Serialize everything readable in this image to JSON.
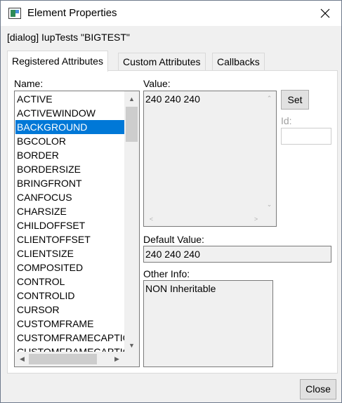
{
  "window": {
    "title": "Element Properties",
    "app_icon": "dialog-app-icon",
    "close_icon": "close-icon"
  },
  "element_label": "[dialog] IupTests \"BIGTEST\"",
  "tabs": [
    {
      "label": "Registered Attributes",
      "active": true
    },
    {
      "label": "Custom Attributes",
      "active": false
    },
    {
      "label": "Callbacks",
      "active": false
    }
  ],
  "name_label": "Name:",
  "attributes": [
    "ACTIVE",
    "ACTIVEWINDOW",
    "BACKGROUND",
    "BGCOLOR",
    "BORDER",
    "BORDERSIZE",
    "BRINGFRONT",
    "CANFOCUS",
    "CHARSIZE",
    "CHILDOFFSET",
    "CLIENTOFFSET",
    "CLIENTSIZE",
    "COMPOSITED",
    "CONTROL",
    "CONTROLID",
    "CURSOR",
    "CUSTOMFRAME",
    "CUSTOMFRAMECAPTIC",
    "CUSTOMFRAMECAPTIC"
  ],
  "selected_index": 2,
  "value_label": "Value:",
  "value_text": "240 240 240",
  "set_label": "Set",
  "id_label": "Id:",
  "id_value": "",
  "default_value_label": "Default Value:",
  "default_value": "240 240 240",
  "other_info_label": "Other Info:",
  "other_info": "NON Inheritable",
  "close_label": "Close",
  "colors": {
    "selection": "#0078d7",
    "window_bg": "#f0f0f0",
    "panel_bg": "#ffffff"
  }
}
